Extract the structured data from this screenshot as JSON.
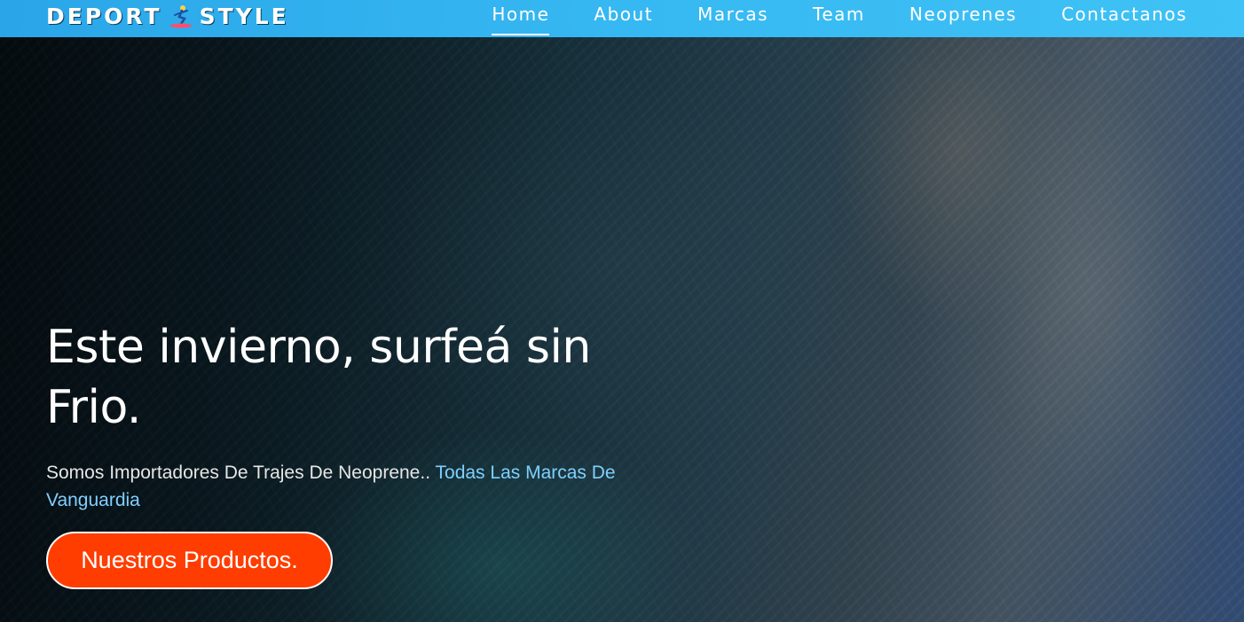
{
  "navbar": {
    "logo_left": "DEPORT",
    "logo_icon": "surfer-icon",
    "logo_right": "STYLE",
    "links": [
      {
        "label": "Home",
        "active": true
      },
      {
        "label": "About",
        "active": false
      },
      {
        "label": "Marcas",
        "active": false
      },
      {
        "label": "Team",
        "active": false
      },
      {
        "label": "Neoprenes",
        "active": false
      },
      {
        "label": "Contactanos",
        "active": false
      }
    ]
  },
  "hero": {
    "headline": "Este invierno, surfeá sin Frio.",
    "subtitle_main": "Somos Importadores De Trajes De Neoprene..",
    "subtitle_highlight": "Todas Las Marcas De Vanguardia",
    "cta_label": "Nuestros Productos."
  },
  "colors": {
    "navbar": "#36b8f2",
    "cta_background": "#ff3d00",
    "highlight_text": "#7fd0ff"
  }
}
